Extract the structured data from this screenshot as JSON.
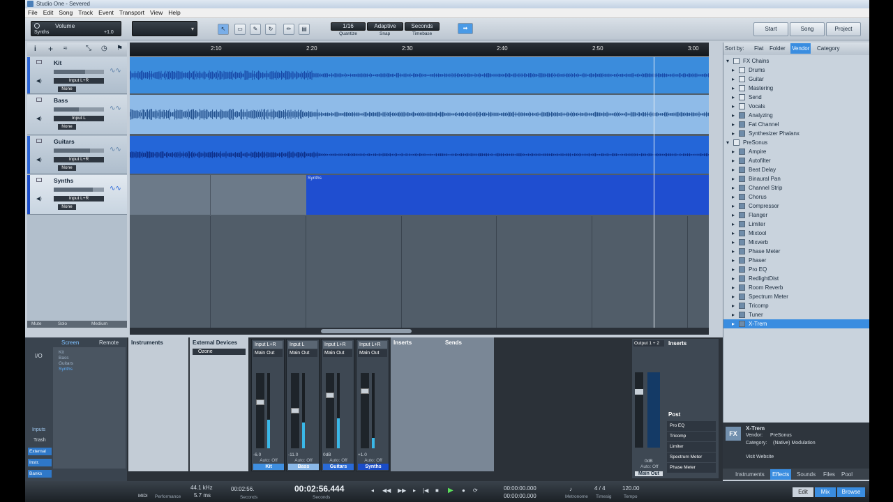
{
  "window": {
    "title": "Studio One - Severed"
  },
  "menu": [
    "File",
    "Edit",
    "Song",
    "Track",
    "Event",
    "Transport",
    "View",
    "Help"
  ],
  "toolbar": {
    "inspector_title": "Volume",
    "inspector_track": "Synths",
    "inspector_value": "+1.0",
    "quantize_value": "1/16",
    "quantize_label": "Quantize",
    "snap_value": "Adaptive",
    "snap_label": "Snap",
    "timebase_value": "Seconds",
    "timebase_label": "Timebase",
    "nav_start": "Start",
    "nav_song": "Song",
    "nav_project": "Project"
  },
  "ruler": {
    "ticks": [
      "2:10",
      "2:20",
      "2:30",
      "2:40",
      "2:50",
      "3:00"
    ]
  },
  "tracks": [
    {
      "name": "Kit",
      "input": "Input L+R",
      "output": "None",
      "volume_fraction": 0.62
    },
    {
      "name": "Bass",
      "input": "Input L",
      "output": "None",
      "volume_fraction": 0.5
    },
    {
      "name": "Guitars",
      "input": "Input L+R",
      "output": "None",
      "volume_fraction": 0.72
    },
    {
      "name": "Synths",
      "input": "Input L+R",
      "output": "None",
      "volume_fraction": 0.78
    }
  ],
  "arrange": {
    "synths_event_label": "Synths"
  },
  "track_footer": {
    "mute": "Mute",
    "solo": "Solo",
    "size": "Medium"
  },
  "browser": {
    "sort_label": "Sort by:",
    "sort_tabs": [
      "Flat",
      "Folder",
      "Vendor",
      "Category"
    ],
    "sort_selected": "Vendor",
    "items": [
      {
        "label": "FX Chains",
        "level": 0,
        "kind": "folder"
      },
      {
        "label": "Drums",
        "level": 1,
        "kind": "folder"
      },
      {
        "label": "Guitar",
        "level": 1,
        "kind": "folder"
      },
      {
        "label": "Mastering",
        "level": 1,
        "kind": "folder"
      },
      {
        "label": "Send",
        "level": 1,
        "kind": "folder"
      },
      {
        "label": "Vocals",
        "level": 1,
        "kind": "folder"
      },
      {
        "label": "Analyzing",
        "level": 1,
        "kind": "chain"
      },
      {
        "label": "Fat Channel",
        "level": 1,
        "kind": "chain"
      },
      {
        "label": "Synthesizer Phalanx",
        "level": 1,
        "kind": "chain"
      },
      {
        "label": "PreSonus",
        "level": 0,
        "kind": "vendor"
      },
      {
        "label": "Ampire",
        "level": 1,
        "kind": "plugin"
      },
      {
        "label": "Autofilter",
        "level": 1,
        "kind": "plugin"
      },
      {
        "label": "Beat Delay",
        "level": 1,
        "kind": "plugin"
      },
      {
        "label": "Binaural Pan",
        "level": 1,
        "kind": "plugin"
      },
      {
        "label": "Channel Strip",
        "level": 1,
        "kind": "plugin"
      },
      {
        "label": "Chorus",
        "level": 1,
        "kind": "plugin"
      },
      {
        "label": "Compressor",
        "level": 1,
        "kind": "plugin"
      },
      {
        "label": "Flanger",
        "level": 1,
        "kind": "plugin"
      },
      {
        "label": "Limiter",
        "level": 1,
        "kind": "plugin"
      },
      {
        "label": "Mixtool",
        "level": 1,
        "kind": "plugin"
      },
      {
        "label": "Mixverb",
        "level": 1,
        "kind": "plugin"
      },
      {
        "label": "Phase Meter",
        "level": 1,
        "kind": "plugin"
      },
      {
        "label": "Phaser",
        "level": 1,
        "kind": "plugin"
      },
      {
        "label": "Pro EQ",
        "level": 1,
        "kind": "plugin"
      },
      {
        "label": "RedlightDist",
        "level": 1,
        "kind": "plugin"
      },
      {
        "label": "Room Reverb",
        "level": 1,
        "kind": "plugin"
      },
      {
        "label": "Spectrum Meter",
        "level": 1,
        "kind": "plugin"
      },
      {
        "label": "Tricomp",
        "level": 1,
        "kind": "plugin"
      },
      {
        "label": "Tuner",
        "level": 1,
        "kind": "plugin"
      },
      {
        "label": "X-Trem",
        "level": 1,
        "kind": "plugin",
        "selected": true
      }
    ],
    "info": {
      "name": "X-Trem",
      "vendor_label": "Vendor:",
      "vendor": "PreSonus",
      "category_label": "Category:",
      "category": "(Native)  Modulation",
      "link": "Visit Website",
      "badge": "FX"
    },
    "tabs": [
      "Instruments",
      "Effects",
      "Sounds",
      "Files",
      "Pool"
    ],
    "active_tab": "Effects"
  },
  "console": {
    "left_tabs": [
      "Screen",
      "Remote"
    ],
    "io_label": "I/O",
    "track_list": [
      "Kit",
      "Bass",
      "Guitars",
      "Synths"
    ],
    "side_buttons": [
      "Inputs",
      "Trash",
      "External",
      "Instr.",
      "Banks"
    ],
    "instruments_label": "Instruments",
    "external_label": "External Devices",
    "external_device": "Ozone",
    "inserts_label": "Inserts",
    "sends_label": "Sends",
    "channels": [
      {
        "input": "Input L+R",
        "output": "Main Out",
        "value": "-6.0",
        "auto": "Auto: Off",
        "name": "Kit",
        "fader": 0.62,
        "meter": 0.38,
        "color": "#3f8fe0"
      },
      {
        "input": "Input L",
        "output": "Main Out",
        "value": "-11.0",
        "auto": "Auto: Off",
        "name": "Bass",
        "fader": 0.5,
        "meter": 0.34,
        "color": "#8ab8e8"
      },
      {
        "input": "Input L+R",
        "output": "Main Out",
        "value": "0dB",
        "auto": "Auto: Off",
        "name": "Guitars",
        "fader": 0.72,
        "meter": 0.4,
        "color": "#2a6ad6"
      },
      {
        "input": "Input L+R",
        "output": "Main Out",
        "value": "+1.0",
        "auto": "Auto: Off",
        "name": "Synths",
        "fader": 0.78,
        "meter": 0.14,
        "color": "#1a4cc8"
      }
    ],
    "master": {
      "io": "Output 1 + 2",
      "value": "0dB",
      "auto": "Auto: Off",
      "name": "Main Out",
      "post_label": "Post",
      "inserts": [
        "Pro EQ",
        "Tricomp",
        "Limiter",
        "Spectrum Meter",
        "Phase Meter"
      ]
    }
  },
  "transport": {
    "midi": "MIDI",
    "sample_rate": "44.1 kHz",
    "latency": "5.7 ms",
    "performance": "Performance",
    "small_time": "00:02:56.",
    "small_time_label": "Seconds",
    "time": "00:02:56.444",
    "time_label": "Seconds",
    "loop_start": "00:00:00.000",
    "loop_end": "00:00:00.000",
    "metronome": "Metronome",
    "timesig": "4 / 4",
    "timesig_label": "Timesig",
    "tempo": "120.00",
    "tempo_label": "Tempo",
    "edit": "Edit",
    "mix": "Mix",
    "browse": "Browse"
  }
}
